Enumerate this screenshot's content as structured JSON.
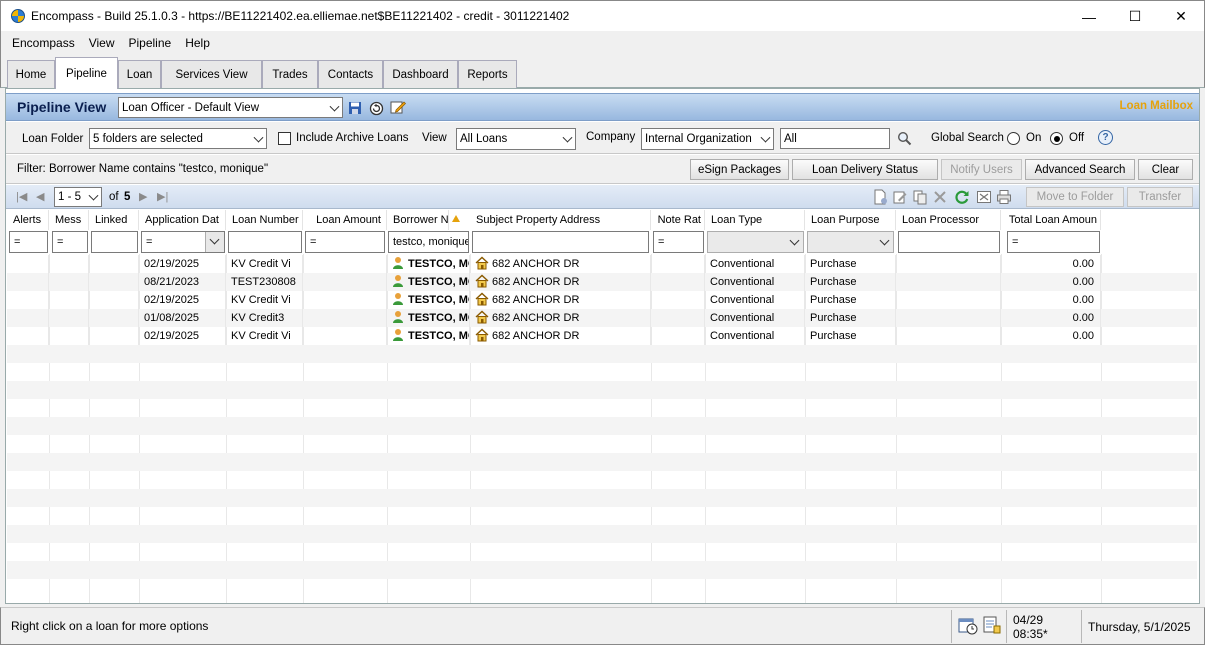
{
  "window": {
    "title": "Encompass - Build 25.1.0.3 - https://BE11221402.ea.elliemae.net$BE11221402 - credit - 3011221402",
    "minimize": "—",
    "maximize": "☐",
    "close": "✕"
  },
  "menu": [
    "Encompass",
    "View",
    "Pipeline",
    "Help"
  ],
  "tabs": [
    "Home",
    "Pipeline",
    "Loan",
    "Services View",
    "Trades",
    "Contacts",
    "Dashboard",
    "Reports"
  ],
  "active_tab": "Pipeline",
  "pipeline": {
    "title": "Pipeline View",
    "view_select": "Loan Officer - Default View",
    "loan_mailbox": "Loan Mailbox"
  },
  "filters": {
    "loan_folder_label": "Loan Folder",
    "loan_folder_value": "5 folders are selected",
    "include_archive_label": "Include Archive Loans",
    "view_label": "View",
    "view_value": "All Loans",
    "company_label": "Company",
    "company_value": "Internal Organization",
    "company_text": "All",
    "global_search_label": "Global Search",
    "on_label": "On",
    "off_label": "Off",
    "help": "?"
  },
  "filter_bar": {
    "text": "Filter:  Borrower Name contains \"testco, monique\"",
    "buttons": {
      "esign": "eSign Packages",
      "delivery": "Loan Delivery Status",
      "notify": "Notify Users",
      "advanced": "Advanced Search",
      "clear": "Clear"
    }
  },
  "pager": {
    "range": "1 - 5",
    "of_label": "of",
    "total": "5",
    "move_to_folder": "Move to Folder",
    "transfer": "Transfer"
  },
  "columns": [
    "Alerts",
    "Mess",
    "Linked",
    "Application Dat",
    "Loan Number",
    "Loan Amount",
    "Borrower N",
    "Subject Property Address",
    "Note Rat",
    "Loan Type",
    "Loan Purpose",
    "Loan Processor",
    "Total Loan Amoun"
  ],
  "column_filters": {
    "alerts": "=",
    "mess": "=",
    "app_date": "=",
    "loan_amount": "=",
    "borrower": "testco, monique",
    "note_rate": "=",
    "total": "="
  },
  "rows": [
    {
      "app_date": "02/19/2025",
      "loan_number": "KV Credit Vi",
      "borrower": "TESTCO, MONIQUE",
      "address": "682 ANCHOR DR",
      "loan_type": "Conventional",
      "purpose": "Purchase",
      "total": "0.00"
    },
    {
      "app_date": "08/21/2023",
      "loan_number": "TEST230808",
      "borrower": "TESTCO, MONIQUE",
      "address": "682 ANCHOR DR",
      "loan_type": "Conventional",
      "purpose": "Purchase",
      "total": "0.00"
    },
    {
      "app_date": "02/19/2025",
      "loan_number": "KV Credit Vi",
      "borrower": "TESTCO, MONIQUE",
      "address": "682 ANCHOR DR",
      "loan_type": "Conventional",
      "purpose": "Purchase",
      "total": "0.00"
    },
    {
      "app_date": "01/08/2025",
      "loan_number": "KV Credit3",
      "borrower": "TESTCO, MONIQUE",
      "address": "682 ANCHOR DR",
      "loan_type": "Conventional",
      "purpose": "Purchase",
      "total": "0.00"
    },
    {
      "app_date": "02/19/2025",
      "loan_number": "KV Credit Vi",
      "borrower": "TESTCO, MONIQUE",
      "address": "682 ANCHOR DR",
      "loan_type": "Conventional",
      "purpose": "Purchase",
      "total": "0.00"
    }
  ],
  "status": {
    "message": "Right click on a loan for more options",
    "time": "04/29 08:35*",
    "date": "Thursday, 5/1/2025"
  },
  "colors": {
    "header_gradient_top": "#c8dcf2",
    "header_gradient_bottom": "#98b8df",
    "mailbox": "#e5a20c",
    "title_text": "#0a1f4f"
  }
}
